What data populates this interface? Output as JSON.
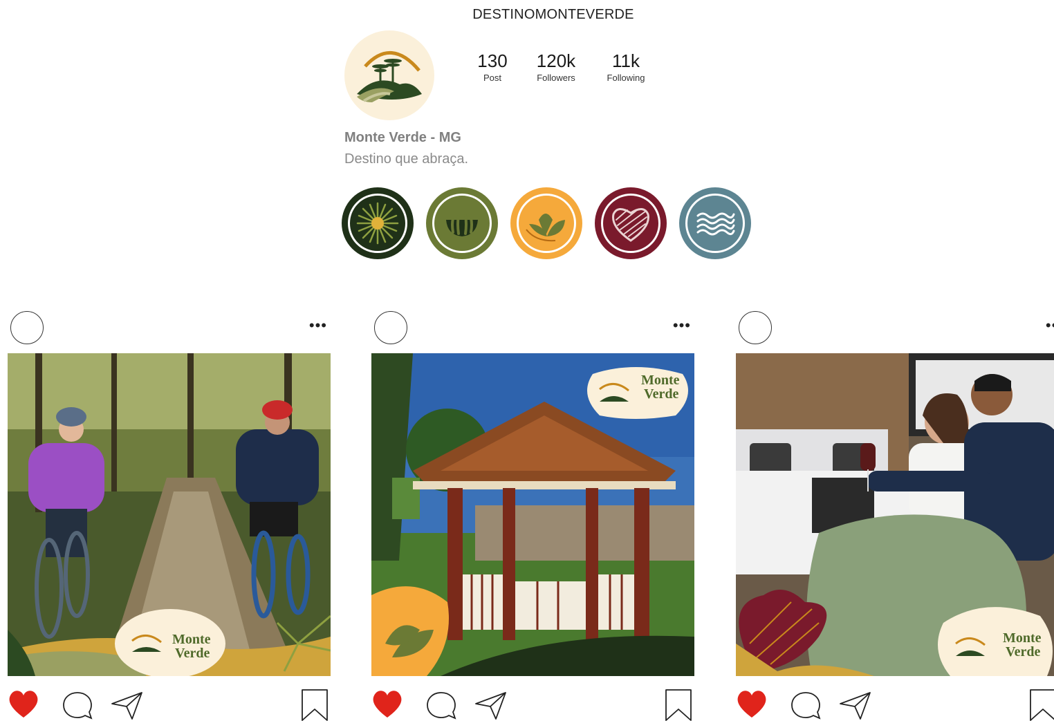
{
  "profile": {
    "username": "DESTINOMONTEVERDE",
    "name": "Monte Verde - MG",
    "bio": "Destino que abraça.",
    "stats": {
      "posts": {
        "value": "130",
        "label": "Post"
      },
      "followers": {
        "value": "120k",
        "label": "Followers"
      },
      "following": {
        "value": "11k",
        "label": "Following"
      }
    }
  },
  "highlights": [
    {
      "icon": "araucaria-burst-icon",
      "color": "#1f3118"
    },
    {
      "icon": "grass-tuft-icon",
      "color": "#6b7a35"
    },
    {
      "icon": "leaf-icon",
      "color": "#f5a93b"
    },
    {
      "icon": "heart-icon",
      "color": "#7a1a2c"
    },
    {
      "icon": "waves-icon",
      "color": "#5d8592"
    }
  ],
  "posts": [
    {
      "scene": "cyclists-forest-trail",
      "brand": {
        "line1": "Monte",
        "line2": "Verde"
      },
      "more": "•••"
    },
    {
      "scene": "gazebo-town-square",
      "brand": {
        "line1": "Monte",
        "line2": "Verde"
      },
      "more": "•••"
    },
    {
      "scene": "couple-wine-bedroom",
      "brand": {
        "line1": "Monte",
        "line2": "Verde"
      },
      "more": "•••"
    }
  ],
  "colors": {
    "heart_red": "#e0241b",
    "brand_green_dark": "#1f3118",
    "brand_green": "#6b7a35",
    "brand_orange": "#f5a93b",
    "brand_wine": "#7a1a2c",
    "brand_blue": "#5d8592"
  }
}
